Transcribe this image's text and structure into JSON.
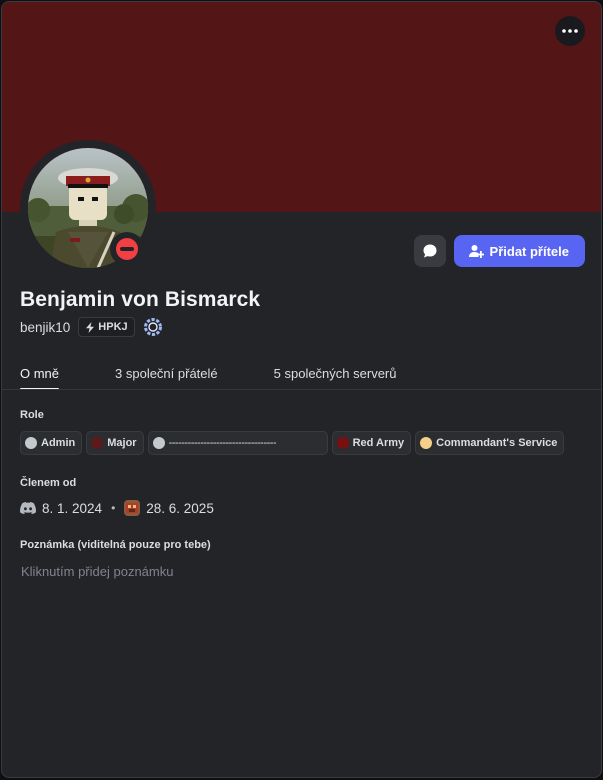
{
  "profile": {
    "display_name": "Benjamin von Bismarck",
    "username": "benjik10",
    "server_tag": "HPKJ",
    "add_friend_label": "Přidat přítele",
    "status": "do-not-disturb"
  },
  "tabs": [
    {
      "label": "O mně",
      "active": true
    },
    {
      "label": "3 společní přátelé",
      "active": false
    },
    {
      "label": "5 společných serverů",
      "active": false
    }
  ],
  "roles_section": {
    "title": "Role",
    "roles": [
      {
        "name": "Admin",
        "color": "#c4c9ce"
      },
      {
        "name": "Major",
        "color": "#5c1a1a"
      },
      {
        "name": "----------------------------------",
        "color": "#c4c9ce"
      },
      {
        "name": "Red Army",
        "color": "#7a0f0f"
      },
      {
        "name": "Commandant's Service",
        "color": "#f5d08a"
      }
    ]
  },
  "member_since": {
    "title": "Členem od",
    "discord_date": "8. 1. 2024",
    "server_date": "28. 6. 2025"
  },
  "note": {
    "title": "Poznámka (viditelná pouze pro tebe)",
    "placeholder": "Kliknutím přidej poznámku"
  },
  "colors": {
    "banner": "#531515",
    "card_bg": "#232428",
    "accent": "#5865f2",
    "dnd_red": "#f23f43"
  },
  "icons": {
    "more": "more-dots-icon",
    "message": "chat-bubble-icon",
    "add_friend": "add-user-icon",
    "tag": "lightning-icon",
    "nitro": "nitro-gem-icon",
    "discord": "discord-logo-icon",
    "status": "dnd-status-icon"
  }
}
